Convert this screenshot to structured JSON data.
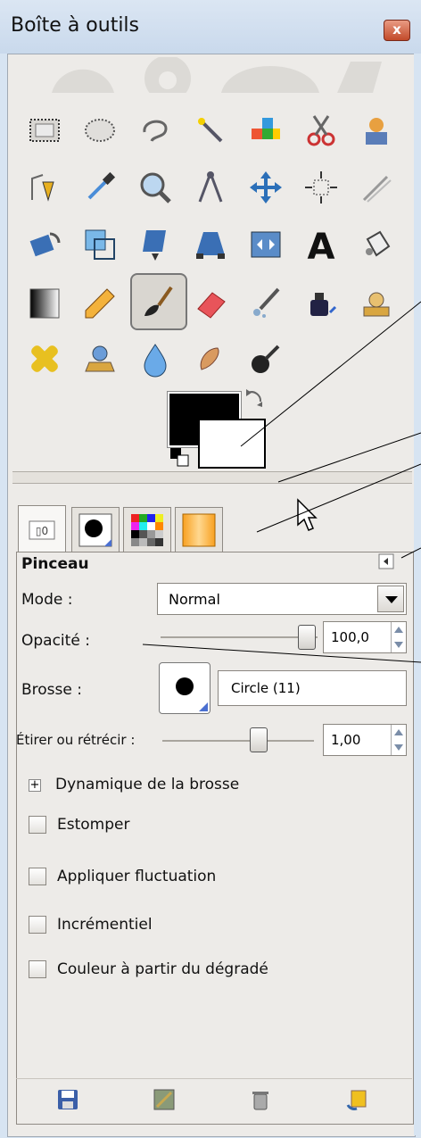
{
  "window": {
    "title": "Boîte à outils",
    "close_label": "x"
  },
  "tools": [
    "rect-select-icon",
    "ellipse-select-icon",
    "free-select-icon",
    "fuzzy-select-icon",
    "select-by-color-icon",
    "scissors-select-icon",
    "foreground-select-icon",
    "paths-icon",
    "color-picker-icon",
    "zoom-icon",
    "measure-icon",
    "move-icon",
    "align-icon",
    "crop-icon",
    "rotate-icon",
    "scale-icon",
    "shear-icon",
    "perspective-icon",
    "flip-icon",
    "text-icon",
    "bucket-fill-icon",
    "blend-icon",
    "pencil-icon",
    "paintbrush-icon",
    "eraser-icon",
    "airbrush-icon",
    "ink-icon",
    "clone-icon",
    "heal-icon",
    "perspective-clone-icon",
    "blur-sharpen-icon",
    "smudge-icon",
    "dodge-burn-icon"
  ],
  "active_tool": "paintbrush-icon",
  "colors": {
    "foreground": "#000000",
    "background": "#ffffff"
  },
  "tabs": [
    "tool-options-tab",
    "brushes-tab",
    "patterns-tab",
    "gradients-tab"
  ],
  "options": {
    "heading": "Pinceau",
    "mode_label": "Mode :",
    "mode_value": "Normal",
    "opacity_label": "Opacité :",
    "opacity_value": "100,0",
    "brush_label": "Brosse :",
    "brush_name": "Circle (11)",
    "scale_label": "Étirer ou rétrécir :",
    "scale_value": "1,00",
    "dynamics_label": "Dynamique de la brosse",
    "checks": [
      {
        "label": "Estomper",
        "checked": false
      },
      {
        "label": "Appliquer fluctuation",
        "checked": false
      },
      {
        "label": "Incrémentiel",
        "checked": false
      },
      {
        "label": "Couleur à partir du dégradé",
        "checked": false
      }
    ]
  },
  "bottom_buttons": [
    "save-options-icon",
    "restore-options-icon",
    "delete-options-icon",
    "reset-options-icon"
  ]
}
